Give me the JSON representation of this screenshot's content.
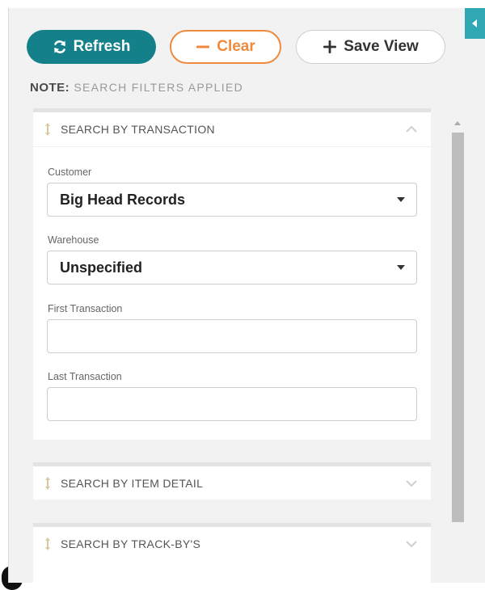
{
  "toolbar": {
    "refresh_label": "Refresh",
    "clear_label": "Clear",
    "save_view_label": "Save View"
  },
  "note": {
    "prefix": "NOTE:",
    "text": "SEARCH FILTERS APPLIED"
  },
  "sections": [
    {
      "title": "SEARCH BY TRANSACTION",
      "expanded": true,
      "fields": {
        "customer": {
          "label": "Customer",
          "value": "Big Head Records"
        },
        "warehouse": {
          "label": "Warehouse",
          "value": "Unspecified"
        },
        "first_transaction": {
          "label": "First Transaction",
          "value": ""
        },
        "last_transaction": {
          "label": "Last Transaction",
          "value": ""
        }
      }
    },
    {
      "title": "SEARCH BY ITEM DETAIL",
      "expanded": false
    },
    {
      "title": "SEARCH BY TRACK-BY'S",
      "expanded": false
    }
  ],
  "icons": {
    "refresh": "refresh-icon",
    "clear": "minus-icon",
    "save_view": "plus-icon",
    "collapse_panel": "caret-left-icon",
    "drag": "drag-handle-icon",
    "expanded": "chevron-up-icon",
    "collapsed": "chevron-down-icon"
  },
  "colors": {
    "primary": "#13808a",
    "clear": "#ef8a3c",
    "collapse_tab": "#2fa8b4",
    "panel_bg": "#f2f2f2"
  }
}
